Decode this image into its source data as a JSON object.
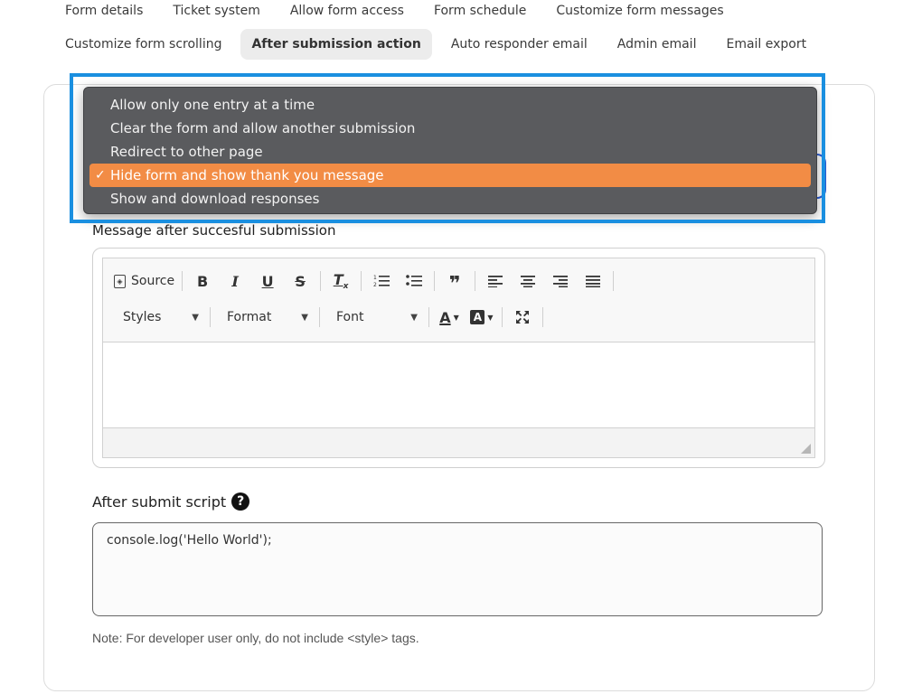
{
  "tabs": {
    "row1": [
      "Form details",
      "Ticket system",
      "Allow form access",
      "Form schedule",
      "Customize form messages"
    ],
    "row2": [
      "Customize form scrolling",
      "After submission action",
      "Auto responder email",
      "Admin email",
      "Email export"
    ],
    "active": "After submission action"
  },
  "dropdown": {
    "options": [
      "Allow only one entry at a time",
      "Clear the form and allow another submission",
      "Redirect to other page",
      "Hide form and show thank you message",
      "Show and download responses"
    ],
    "selected_index": 3,
    "check_glyph": "✓"
  },
  "message_label": "Message after succesful submission",
  "editor": {
    "source_label": "Source",
    "styles_label": "Styles",
    "format_label": "Format",
    "font_label": "Font",
    "content": ""
  },
  "script": {
    "label": "After submit script",
    "help_glyph": "?",
    "value": "console.log('Hello World');"
  },
  "note": "Note: For developer user only, do not include <style> tags.",
  "colors": {
    "highlight": "#1a8fe0",
    "selected_option": "#f28c45",
    "dropdown_bg": "#5a5b5e"
  }
}
